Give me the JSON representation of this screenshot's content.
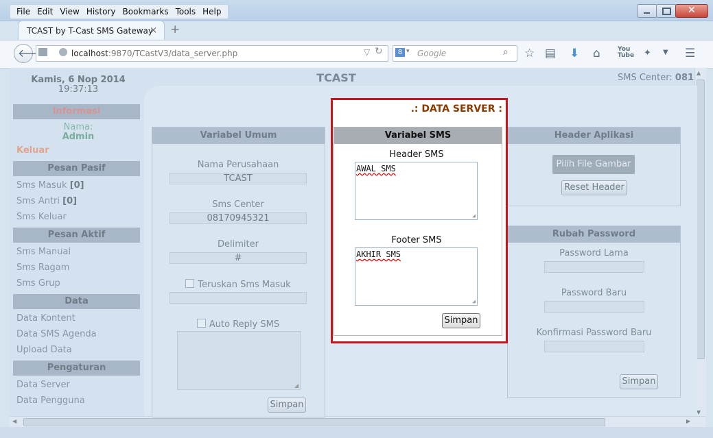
{
  "menu": [
    "File",
    "Edit",
    "View",
    "History",
    "Bookmarks",
    "Tools",
    "Help"
  ],
  "tab": {
    "title": "TCAST by T-Cast SMS Gateway",
    "close": "×",
    "new_tab": "+"
  },
  "url": {
    "host": "localhost",
    "rest": ":9870/TCastV3/data_server.php"
  },
  "search": {
    "engine_icon": "google-icon",
    "placeholder": "Google"
  },
  "header": {
    "date": "Kamis, 6 Nop 2014",
    "time": "19:37:13",
    "brand": "TCAST",
    "sms_center_label": "SMS Center:",
    "sms_center_value": "081"
  },
  "sidebar": {
    "informasi": "Informasi",
    "nama_label": "Nama:",
    "nama_value": "Admin",
    "keluar": "Keluar",
    "pesan_pasif": "Pesan Pasif",
    "sms_masuk": "Sms Masuk",
    "sms_masuk_count": "[0]",
    "sms_antri": "Sms Antri",
    "sms_antri_count": "[0]",
    "sms_keluar": "Sms Keluar",
    "pesan_aktif": "Pesan Aktif",
    "sms_manual": "Sms Manual",
    "sms_ragam": "Sms Ragam",
    "sms_grup": "Sms Grup",
    "data": "Data",
    "data_kontent": "Data Kontent",
    "data_sms_agenda": "Data SMS Agenda",
    "upload_data": "Upload Data",
    "pengaturan": "Pengaturan",
    "data_server": "Data Server",
    "data_pengguna": "Data Pengguna"
  },
  "data_server_title": ".: DATA SERVER :",
  "variabel_umum": {
    "title": "Variabel Umum",
    "nama_perusahaan_label": "Nama Perusahaan",
    "nama_perusahaan_value": "TCAST",
    "sms_center_label": "Sms Center",
    "sms_center_value": "08170945321",
    "delimiter_label": "Delimiter",
    "delimiter_value": "#",
    "teruskan_label": "Teruskan Sms Masuk",
    "auto_reply_label": "Auto Reply SMS",
    "simpan": "Simpan"
  },
  "variabel_sms": {
    "title": "Variabel SMS",
    "header_label": "Header SMS",
    "header_value": "AWAL SMS",
    "footer_label": "Footer SMS",
    "footer_value": "AKHIR SMS",
    "simpan": "Simpan"
  },
  "header_aplikasi": {
    "title": "Header Aplikasi",
    "pilih_file": "Pilih File Gambar",
    "reset": "Reset Header"
  },
  "rubah_password": {
    "title": "Rubah Password",
    "lama": "Password Lama",
    "baru": "Password Baru",
    "konfirmasi": "Konfirmasi Password Baru",
    "simpan": "Simpan"
  }
}
